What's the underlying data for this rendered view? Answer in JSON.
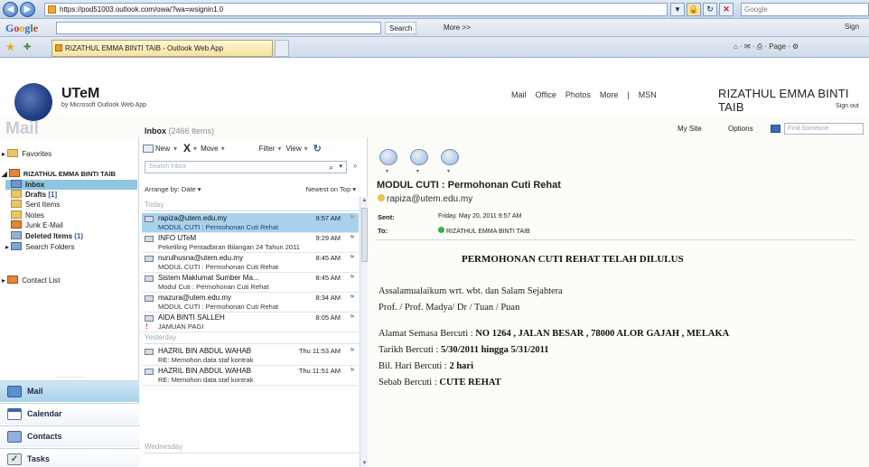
{
  "browser": {
    "url": "https://pod51003.outlook.com/owa/?wa=wsignin1.0",
    "search_placeholder": "Google",
    "google_search_label": "Search",
    "google_more_label": "More >>",
    "google_signin": "Sign",
    "tab_title": "RIZATHUL EMMA BINTI TAIB - Outlook Web App",
    "command_bar": "⌂ · ✉ · ⎙ · Page · ⚙"
  },
  "header": {
    "org_name": "UTeM",
    "org_sub": "by Microsoft Outlook Web App",
    "nav": [
      "Mail",
      "Office",
      "Photos",
      "More",
      "|",
      "MSN"
    ],
    "user_name": "RIZATHUL EMMA BINTI TAIB",
    "sign_out": "Sign out",
    "mail_title": "Mail",
    "my_site": "My Site",
    "options": "Options",
    "find_someone_placeholder": "Find Someone"
  },
  "inbox": {
    "label": "Inbox",
    "count": "(2466 Items)"
  },
  "folders": {
    "favorites": "Favorites",
    "mailbox": "RIZATHUL EMMA BINTI TAIB",
    "items": [
      {
        "label": "Inbox",
        "count": ""
      },
      {
        "label": "Drafts",
        "count": "[1]"
      },
      {
        "label": "Sent Items",
        "count": ""
      },
      {
        "label": "Notes",
        "count": ""
      },
      {
        "label": "Junk E-Mail",
        "count": ""
      },
      {
        "label": "Deleted Items",
        "count": "(1)"
      },
      {
        "label": "Search Folders",
        "count": ""
      }
    ],
    "contact_list": "Contact List",
    "separator": "..........."
  },
  "modules": {
    "mail": "Mail",
    "calendar": "Calendar",
    "contacts": "Contacts",
    "tasks": "Tasks"
  },
  "list_toolbar": {
    "new": "New",
    "delete": "X",
    "move": "Move",
    "filter": "Filter",
    "view": "View",
    "search_placeholder": "Search Inbox",
    "arrange_by": "Arrange by: Date",
    "sort_order": "Newest on Top"
  },
  "groups": {
    "today": "Today",
    "yesterday": "Yesterday",
    "wednesday": "Wednesday"
  },
  "messages": [
    {
      "from": "rapiza@utem.edu.my",
      "subject": "MODUL CUTI : Permohonan Cuti Rehat",
      "time": "9:57 AM"
    },
    {
      "from": "INFO UTeM",
      "subject": "Pekeliling Pentadbiran Bilangan 24 Tahun 2011",
      "time": "9:29 AM"
    },
    {
      "from": "nurulhusna@utem.edu.my",
      "subject": "MODUL CUTI : Permohonan Cuti Rehat",
      "time": "8:45 AM"
    },
    {
      "from": "Sistem Maklumat Sumber Ma...",
      "subject": "Modul Cuti : Permohonan Cuti Rehat",
      "time": "8:45 AM"
    },
    {
      "from": "mazura@utem.edu.my",
      "subject": "MODUL CUTI : Permohonan Cuti Rehat",
      "time": "8:34 AM"
    },
    {
      "from": "AIDA BINTI SALLEH",
      "subject": "JAMUAN PAGI",
      "time": "8:05 AM",
      "importance": "!"
    },
    {
      "from": "HAZRIL BIN ABDUL WAHAB",
      "subject": "RE: Memohon data staf kontrak",
      "time": "Thu 11:53 AM"
    },
    {
      "from": "HAZRIL BIN ABDUL WAHAB",
      "subject": "RE: Memohon data staf kontrak",
      "time": "Thu 11:51 AM"
    }
  ],
  "reading": {
    "subject": "MODUL CUTI : Permohonan Cuti Rehat",
    "from": "rapiza@utem.edu.my",
    "sent_label": "Sent:",
    "sent_value": "Friday, May 20, 2011 9:57 AM",
    "to_label": "To:",
    "to_value": "RIZATHUL EMMA BINTI TAIB",
    "body_title": "PERMOHONAN CUTI REHAT TELAH DILULUS",
    "greeting": "Assalamualaikum wrt. wbt. dan Salam Sejahtera",
    "salutation": "Prof. / Prof. Madya/ Dr / Tuan / Puan",
    "address_label": "Alamat Semasa Bercuti :",
    "address_value": "NO 1264 , JALAN BESAR , 78000 ALOR GAJAH , MELAKA",
    "dates_label": "Tarikh Bercuti :",
    "dates_value": "5/30/2011 hingga 5/31/2011",
    "days_label": "Bil. Hari Bercuti :",
    "days_value": "2 hari",
    "reason_label": "Sebab Bercuti :",
    "reason_value": "CUTE REHAT"
  }
}
